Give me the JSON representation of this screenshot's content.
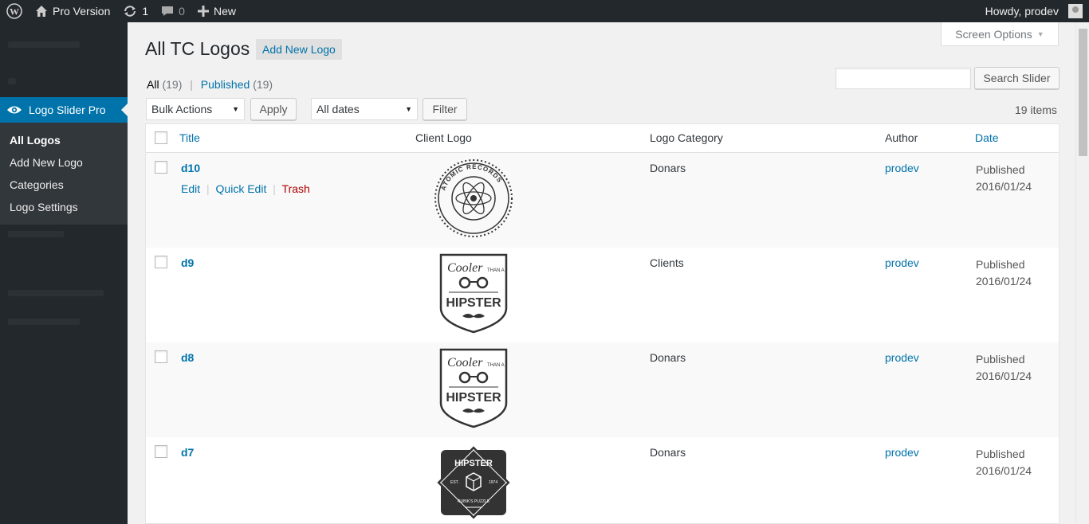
{
  "adminbar": {
    "site_name": "Pro Version",
    "updates_count": "1",
    "comments_count": "0",
    "new_label": "New",
    "greeting": "Howdy, prodev"
  },
  "sidebar": {
    "plugin_menu": "Logo Slider Pro",
    "submenu": [
      "All Logos",
      "Add New Logo",
      "Categories",
      "Logo Settings"
    ]
  },
  "page": {
    "title": "All TC Logos",
    "add_new": "Add New Logo",
    "screen_options": "Screen Options",
    "filter_all": "All",
    "filter_all_count": "(19)",
    "filter_sep": "|",
    "filter_published": "Published",
    "filter_published_count": "(19)",
    "search_placeholder": "",
    "search_button": "Search Slider",
    "bulk_actions": "Bulk Actions",
    "apply": "Apply",
    "all_dates": "All dates",
    "filter_button": "Filter",
    "items_count": "19 items"
  },
  "table": {
    "columns": [
      "Title",
      "Client Logo",
      "Logo Category",
      "Author",
      "Date"
    ],
    "row_actions": {
      "edit": "Edit",
      "quick_edit": "Quick Edit",
      "trash": "Trash",
      "sep": "|"
    },
    "rows": [
      {
        "title": "d10",
        "logo": "atomic-records-logo",
        "category": "Donars",
        "author": "prodev",
        "status": "Published",
        "date": "2016/01/24"
      },
      {
        "title": "d9",
        "logo": "cooler-hipster-logo",
        "category": "Clients",
        "author": "prodev",
        "status": "Published",
        "date": "2016/01/24"
      },
      {
        "title": "d8",
        "logo": "cooler-hipster-logo",
        "category": "Donars",
        "author": "prodev",
        "status": "Published",
        "date": "2016/01/24"
      },
      {
        "title": "d7",
        "logo": "hipster-rubiks-logo",
        "category": "Donars",
        "author": "prodev",
        "status": "Published",
        "date": "2016/01/24"
      }
    ]
  },
  "logo_texts": {
    "atomic": "ATOMIC RECORDS",
    "cooler": "Cooler",
    "than_a": "THAN A",
    "hipster": "HIPSTER",
    "est": "EST.",
    "year": "1974",
    "rubiks": "RUBIK'S PUZZLE"
  },
  "colors": {
    "admin_bar": "#23282d",
    "accent": "#0073aa",
    "trash": "#a00000"
  }
}
